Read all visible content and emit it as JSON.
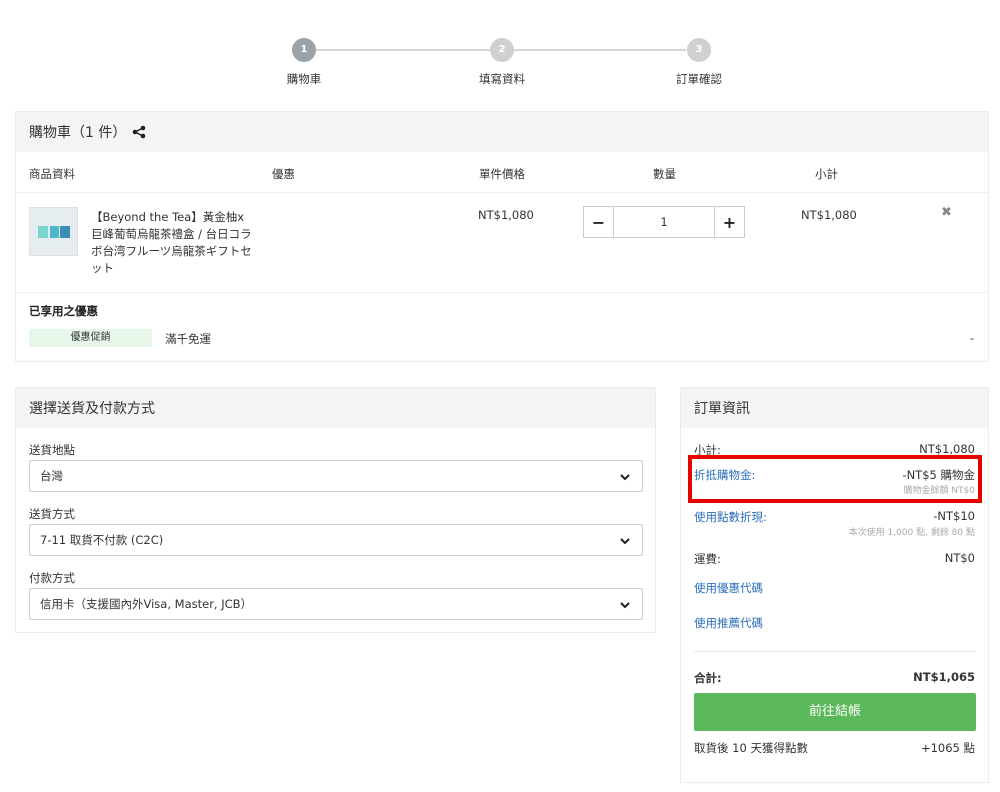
{
  "steps": [
    {
      "num": "1",
      "label": "購物車"
    },
    {
      "num": "2",
      "label": "填寫資料"
    },
    {
      "num": "3",
      "label": "訂單確認"
    }
  ],
  "cart": {
    "title": "購物車（1 件）",
    "columns": {
      "product": "商品資料",
      "promo": "優惠",
      "price": "單件價格",
      "quantity": "數量",
      "subtotal": "小計"
    },
    "item": {
      "name": "【Beyond the Tea】黃金柚x巨峰葡萄烏龍茶禮盒 / 台日コラボ台湾フルーツ烏龍茶ギフトセット",
      "price": "NT$1,080",
      "quantity": "1",
      "subtotal": "NT$1,080",
      "minus": "−",
      "plus": "+",
      "remove": "✖"
    },
    "applied_title": "已享用之優惠",
    "promo_tag": "優惠促銷",
    "promo_name": "滿千免運",
    "promo_value": "-"
  },
  "shipping": {
    "title": "選擇送貨及付款方式",
    "location_label": "送貨地點",
    "location_value": "台灣",
    "method_label": "送貨方式",
    "method_value": "7-11 取貨不付款 (C2C)",
    "payment_label": "付款方式",
    "payment_value": "信用卡（支援國內外Visa, Master, JCB）"
  },
  "order": {
    "title": "訂單資訊",
    "subtotal_label": "小計:",
    "subtotal_value": "NT$1,080",
    "credit_label": "折抵購物金:",
    "credit_value": "-NT$5 購物金",
    "credit_note": "購物金餘額 NT$0",
    "points_label": "使用點數折現:",
    "points_value": "-NT$10",
    "points_note": "本次使用 1,000 點, 剩餘 80 點",
    "shipping_label": "運費:",
    "shipping_value": "NT$0",
    "coupon_link": "使用優惠代碼",
    "referral_link": "使用推薦代碼",
    "total_label": "合計:",
    "total_value": "NT$1,065",
    "checkout_label": "前往結帳",
    "earn_label": "取貨後 10 天獲得點數",
    "earn_value": "+1065 點"
  },
  "colors": {
    "accent_green": "#5cb85c",
    "link_blue": "#2a6ebb",
    "highlight_red": "#e60000",
    "promo_bg": "#e6f6e9"
  }
}
